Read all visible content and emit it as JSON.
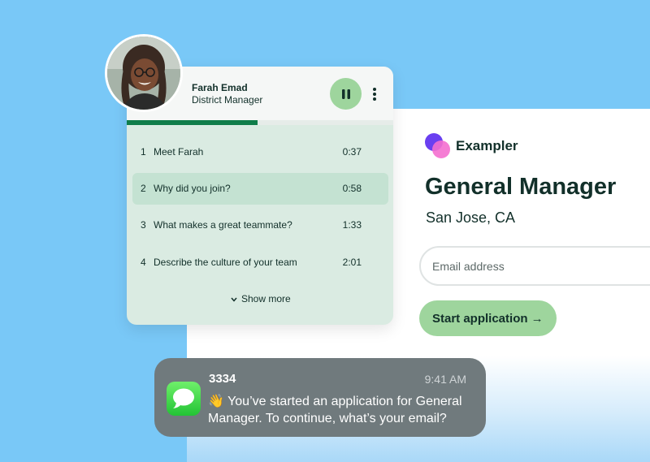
{
  "job": {
    "brand": "Exampler",
    "title": "General Manager",
    "location": "San Jose, CA",
    "email_placeholder": "Email address",
    "email_value": "",
    "cta_label": "Start application →"
  },
  "video": {
    "name": "Farah Emad",
    "role": "District Manager",
    "progress_fraction": 0.49,
    "questions": [
      {
        "num": "1",
        "text": "Meet Farah",
        "time": "0:37",
        "active": false
      },
      {
        "num": "2",
        "text": "Why did you join?",
        "time": "0:58",
        "active": true
      },
      {
        "num": "3",
        "text": "What makes a great teammate?",
        "time": "1:33",
        "active": false
      },
      {
        "num": "4",
        "text": "Describe the culture of your team",
        "time": "2:01",
        "active": false
      }
    ],
    "show_more": "Show more"
  },
  "notification": {
    "sender": "3334",
    "time": "9:41 AM",
    "body": "👋 You’ve started an application for General Manager. To continue, what’s your email?"
  },
  "colors": {
    "background": "#79c8f7",
    "accent_green": "#9ed59d",
    "progress": "#0f7d4a",
    "brand_purple": "#6a3ff0",
    "brand_pink": "#f46fcf",
    "text_dark": "#12302a"
  },
  "icons": {
    "pause": "pause-icon",
    "more": "more-vertical-icon",
    "chevron": "chevron-down-icon",
    "messages": "messages-app-icon",
    "logo": "exampler-logo"
  }
}
